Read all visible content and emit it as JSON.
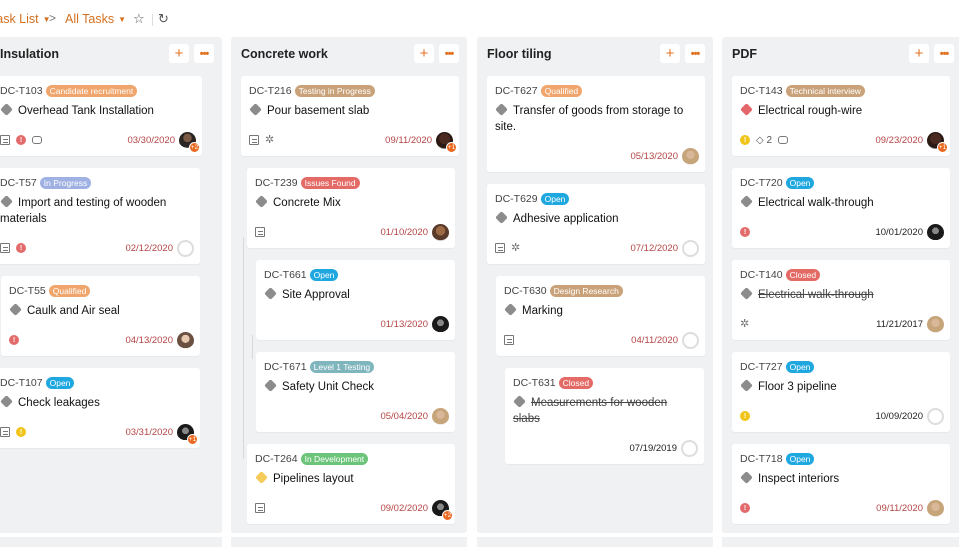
{
  "topbar": {
    "breadcrumb_1": "Task List",
    "breadcrumb_2": "All Tasks",
    "separator": ">",
    "caret": "▼",
    "star_icon": "☆",
    "refresh_icon": "↻"
  },
  "column_actions": {
    "add": "+",
    "more": "•••"
  },
  "columns": [
    {
      "title": "Insulation",
      "cards": [
        {
          "id": "DC-T103",
          "status": "Candidate recruitment",
          "status_color": "#efa56b",
          "title": "Overhead Tank Installation",
          "priority": "gray",
          "date": "03/30/2020",
          "date_color": "red",
          "icons": [
            "subtasks",
            "alert-red",
            "comment"
          ],
          "avatar": "a1",
          "extra": "+2"
        },
        {
          "id": "DC-T57",
          "status": "In Progress",
          "status_color": "#9fb0e3",
          "title": "Import and testing of wooden materials",
          "priority": "gray",
          "date": "02/12/2020",
          "date_color": "red",
          "icons": [
            "subtasks",
            "alert-red"
          ],
          "avatar": "empty",
          "extra": ""
        },
        {
          "id": "DC-T55",
          "status": "Qualified",
          "status_color": "#efa56b",
          "title": "Caulk and Air seal",
          "priority": "gray",
          "date": "04/13/2020",
          "date_color": "red",
          "icons": [
            "alert-red"
          ],
          "avatar": "a2",
          "extra": ""
        },
        {
          "id": "DC-T107",
          "status": "Open",
          "status_color": "#1fa7e0",
          "title": "Check leakages",
          "priority": "gray",
          "date": "03/31/2020",
          "date_color": "red",
          "icons": [
            "subtasks",
            "alert-yellow"
          ],
          "avatar": "a5",
          "extra": "+1"
        }
      ]
    },
    {
      "title": "Concrete work",
      "cards": [
        {
          "id": "DC-T216",
          "status": "Testing in Progress",
          "status_color": "#c9a27a",
          "title": "Pour basement slab",
          "priority": "gray",
          "date": "09/11/2020",
          "date_color": "red",
          "icons": [
            "subtasks",
            "bug"
          ],
          "avatar": "a6",
          "extra": "+1"
        },
        {
          "id": "DC-T239",
          "status": "Issues Found",
          "status_color": "#e46a66",
          "title": "Concrete Mix",
          "priority": "gray",
          "date": "01/10/2020",
          "date_color": "red",
          "icons": [
            "subtasks"
          ],
          "avatar": "a4",
          "extra": ""
        },
        {
          "id": "DC-T661",
          "status": "Open",
          "status_color": "#1fa7e0",
          "title": "Site Approval",
          "priority": "gray",
          "date": "01/13/2020",
          "date_color": "red",
          "icons": [],
          "avatar": "a5",
          "extra": ""
        },
        {
          "id": "DC-T671",
          "status": "Level 1 Testing",
          "status_color": "#7fb5bd",
          "title": "Safety Unit Check",
          "priority": "gray",
          "date": "05/04/2020",
          "date_color": "red",
          "icons": [],
          "avatar": "a3",
          "extra": ""
        },
        {
          "id": "DC-T264",
          "status": "In Development",
          "status_color": "#6cc47a",
          "title": "Pipelines layout",
          "priority": "yellow",
          "date": "09/02/2020",
          "date_color": "red",
          "icons": [
            "subtasks"
          ],
          "avatar": "a5",
          "extra": "+2"
        }
      ]
    },
    {
      "title": "Floor tiling",
      "cards": [
        {
          "id": "DC-T627",
          "status": "Qualified",
          "status_color": "#efa56b",
          "title": "Transfer of goods from storage to site.",
          "priority": "gray",
          "date": "05/13/2020",
          "date_color": "red",
          "icons": [],
          "avatar": "a3",
          "extra": ""
        },
        {
          "id": "DC-T629",
          "status": "Open",
          "status_color": "#1fa7e0",
          "title": "Adhesive application",
          "priority": "gray",
          "date": "07/12/2020",
          "date_color": "red",
          "icons": [
            "subtasks",
            "bug"
          ],
          "avatar": "empty",
          "extra": ""
        },
        {
          "id": "DC-T630",
          "status": "Design Research",
          "status_color": "#c9a27a",
          "title": "Marking",
          "priority": "gray",
          "date": "04/11/2020",
          "date_color": "red",
          "icons": [
            "subtasks"
          ],
          "avatar": "empty",
          "extra": ""
        },
        {
          "id": "DC-T631",
          "status": "Closed",
          "status_color": "#e46a66",
          "title": "Measurements for wooden slabs",
          "priority": "gray",
          "strike": true,
          "date": "07/19/2019",
          "date_color": "black",
          "icons": [],
          "avatar": "empty",
          "extra": ""
        }
      ]
    },
    {
      "title": "PDF",
      "cards": [
        {
          "id": "DC-T143",
          "status": "Technical interview",
          "status_color": "#c9a27a",
          "title": "Electrical rough-wire",
          "priority": "red",
          "date": "09/23/2020",
          "date_color": "red",
          "icons": [
            "alert-yellow",
            "tag",
            "comment"
          ],
          "tag_count": "2",
          "avatar": "a6",
          "extra": "+1"
        },
        {
          "id": "DC-T720",
          "status": "Open",
          "status_color": "#1fa7e0",
          "title": "Electrical walk-through",
          "priority": "gray",
          "date": "10/01/2020",
          "date_color": "black",
          "icons": [
            "alert-red"
          ],
          "avatar": "a5",
          "extra": ""
        },
        {
          "id": "DC-T140",
          "status": "Closed",
          "status_color": "#e46a66",
          "title": "Electrical walk-through",
          "priority": "gray",
          "strike": true,
          "date": "11/21/2017",
          "date_color": "black",
          "icons": [
            "bug"
          ],
          "avatar": "a3",
          "extra": ""
        },
        {
          "id": "DC-T727",
          "status": "Open",
          "status_color": "#1fa7e0",
          "title": "Floor 3 pipeline",
          "priority": "gray",
          "date": "10/09/2020",
          "date_color": "black",
          "icons": [
            "alert-yellow"
          ],
          "avatar": "empty",
          "extra": ""
        },
        {
          "id": "DC-T718",
          "status": "Open",
          "status_color": "#1fa7e0",
          "title": "Inspect interiors",
          "priority": "gray",
          "date": "09/11/2020",
          "date_color": "red",
          "icons": [
            "alert-red"
          ],
          "avatar": "a3",
          "extra": ""
        }
      ]
    }
  ]
}
